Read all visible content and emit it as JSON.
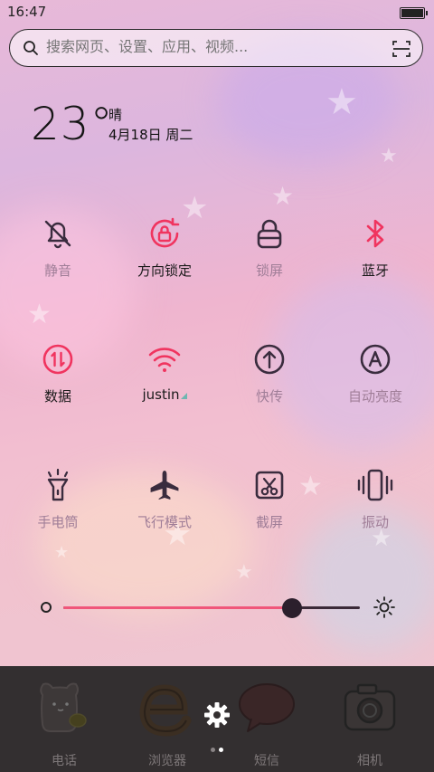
{
  "status_bar": {
    "time": "16:47",
    "battery_level": 0.95
  },
  "search": {
    "placeholder": "搜索网页、设置、应用、视频..."
  },
  "weather": {
    "temperature": "23°",
    "condition": "晴",
    "date": "4月18日 周二"
  },
  "toggles": [
    {
      "label": "静音",
      "icon": "bell-off-icon",
      "active": false
    },
    {
      "label": "方向锁定",
      "icon": "rotation-lock-icon",
      "active": true
    },
    {
      "label": "锁屏",
      "icon": "lock-icon",
      "active": false
    },
    {
      "label": "蓝牙",
      "icon": "bluetooth-icon",
      "active": true
    },
    {
      "label": "数据",
      "icon": "mobile-data-icon",
      "active": true
    },
    {
      "label": "justin",
      "icon": "wifi-icon",
      "active": true
    },
    {
      "label": "快传",
      "icon": "quick-share-icon",
      "active": false
    },
    {
      "label": "自动亮度",
      "icon": "auto-brightness-icon",
      "active": false
    },
    {
      "label": "手电筒",
      "icon": "flashlight-icon",
      "active": false
    },
    {
      "label": "飞行模式",
      "icon": "airplane-icon",
      "active": false
    },
    {
      "label": "截屏",
      "icon": "screenshot-icon",
      "active": false
    },
    {
      "label": "振动",
      "icon": "vibrate-icon",
      "active": false
    }
  ],
  "brightness": {
    "level": 0.77
  },
  "dock": {
    "apps": [
      {
        "label": "电话",
        "icon": "phone-app-icon"
      },
      {
        "label": "浏览器",
        "icon": "browser-app-icon"
      },
      {
        "label": "短信",
        "icon": "messages-app-icon"
      },
      {
        "label": "相机",
        "icon": "camera-app-icon"
      }
    ],
    "page_count": 2,
    "current_page": 2
  },
  "colors": {
    "accent": "#f0345f",
    "inactive": "#3a2c3e",
    "dock_bg": "#332f30"
  }
}
